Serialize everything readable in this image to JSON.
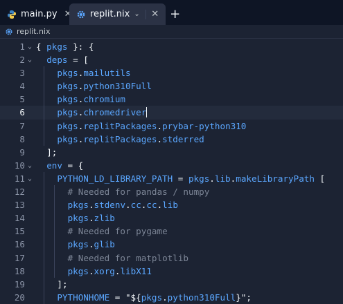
{
  "tabs": [
    {
      "label": "main.py",
      "icon": "python-icon",
      "active": false
    },
    {
      "label": "replit.nix",
      "icon": "nix-gear-icon",
      "active": true
    }
  ],
  "breadcrumb": {
    "label": "replit.nix",
    "icon": "nix-gear-icon"
  },
  "colors": {
    "accent": "#5ba7ff",
    "comment": "#7c8596",
    "background": "#1c2333",
    "tabbar": "#0e1525"
  },
  "editor": {
    "current_line": 6,
    "lines": [
      {
        "n": "1",
        "fold": true,
        "indent": 0,
        "tokens": [
          [
            "punc",
            "{ "
          ],
          [
            "var",
            "pkgs"
          ],
          [
            "punc",
            " }: {"
          ]
        ]
      },
      {
        "n": "2",
        "fold": true,
        "indent": 1,
        "tokens": [
          [
            "var",
            "deps"
          ],
          [
            "punc",
            " = ["
          ]
        ]
      },
      {
        "n": "3",
        "fold": false,
        "indent": 2,
        "tokens": [
          [
            "var",
            "pkgs"
          ],
          [
            "punc",
            "."
          ],
          [
            "attr",
            "mailutils"
          ]
        ]
      },
      {
        "n": "4",
        "fold": false,
        "indent": 2,
        "tokens": [
          [
            "var",
            "pkgs"
          ],
          [
            "punc",
            "."
          ],
          [
            "attr",
            "python310Full"
          ]
        ]
      },
      {
        "n": "5",
        "fold": false,
        "indent": 2,
        "tokens": [
          [
            "var",
            "pkgs"
          ],
          [
            "punc",
            "."
          ],
          [
            "attr",
            "chromium"
          ]
        ]
      },
      {
        "n": "6",
        "fold": false,
        "indent": 2,
        "cursor": true,
        "tokens": [
          [
            "var",
            "pkgs"
          ],
          [
            "punc",
            "."
          ],
          [
            "attr",
            "chromedriver"
          ]
        ]
      },
      {
        "n": "7",
        "fold": false,
        "indent": 2,
        "tokens": [
          [
            "var",
            "pkgs"
          ],
          [
            "punc",
            "."
          ],
          [
            "attr",
            "replitPackages"
          ],
          [
            "punc",
            "."
          ],
          [
            "attr",
            "prybar-python310"
          ]
        ]
      },
      {
        "n": "8",
        "fold": false,
        "indent": 2,
        "tokens": [
          [
            "var",
            "pkgs"
          ],
          [
            "punc",
            "."
          ],
          [
            "attr",
            "replitPackages"
          ],
          [
            "punc",
            "."
          ],
          [
            "attr",
            "stderred"
          ]
        ]
      },
      {
        "n": "9",
        "fold": false,
        "indent": 1,
        "tokens": [
          [
            "punc",
            "];"
          ]
        ]
      },
      {
        "n": "10",
        "fold": true,
        "indent": 1,
        "tokens": [
          [
            "var",
            "env"
          ],
          [
            "punc",
            " = {"
          ]
        ]
      },
      {
        "n": "11",
        "fold": true,
        "indent": 2,
        "tokens": [
          [
            "var",
            "PYTHON_LD_LIBRARY_PATH"
          ],
          [
            "punc",
            " = "
          ],
          [
            "var",
            "pkgs"
          ],
          [
            "punc",
            "."
          ],
          [
            "attr",
            "lib"
          ],
          [
            "punc",
            "."
          ],
          [
            "attr",
            "makeLibraryPath"
          ],
          [
            "punc",
            " ["
          ]
        ]
      },
      {
        "n": "12",
        "fold": false,
        "indent": 3,
        "tokens": [
          [
            "comment",
            "# Needed for pandas / numpy"
          ]
        ]
      },
      {
        "n": "13",
        "fold": false,
        "indent": 3,
        "tokens": [
          [
            "var",
            "pkgs"
          ],
          [
            "punc",
            "."
          ],
          [
            "attr",
            "stdenv"
          ],
          [
            "punc",
            "."
          ],
          [
            "attr",
            "cc"
          ],
          [
            "punc",
            "."
          ],
          [
            "attr",
            "cc"
          ],
          [
            "punc",
            "."
          ],
          [
            "attr",
            "lib"
          ]
        ]
      },
      {
        "n": "14",
        "fold": false,
        "indent": 3,
        "tokens": [
          [
            "var",
            "pkgs"
          ],
          [
            "punc",
            "."
          ],
          [
            "attr",
            "zlib"
          ]
        ]
      },
      {
        "n": "15",
        "fold": false,
        "indent": 3,
        "tokens": [
          [
            "comment",
            "# Needed for pygame"
          ]
        ]
      },
      {
        "n": "16",
        "fold": false,
        "indent": 3,
        "tokens": [
          [
            "var",
            "pkgs"
          ],
          [
            "punc",
            "."
          ],
          [
            "attr",
            "glib"
          ]
        ]
      },
      {
        "n": "17",
        "fold": false,
        "indent": 3,
        "tokens": [
          [
            "comment",
            "# Needed for matplotlib"
          ]
        ]
      },
      {
        "n": "18",
        "fold": false,
        "indent": 3,
        "tokens": [
          [
            "var",
            "pkgs"
          ],
          [
            "punc",
            "."
          ],
          [
            "attr",
            "xorg"
          ],
          [
            "punc",
            "."
          ],
          [
            "attr",
            "libX11"
          ]
        ]
      },
      {
        "n": "19",
        "fold": false,
        "indent": 2,
        "tokens": [
          [
            "punc",
            "];"
          ]
        ]
      },
      {
        "n": "20",
        "fold": false,
        "indent": 2,
        "tokens": [
          [
            "var",
            "PYTHONHOME"
          ],
          [
            "punc",
            " = \"${"
          ],
          [
            "var",
            "pkgs"
          ],
          [
            "punc",
            "."
          ],
          [
            "attr",
            "python310Full"
          ],
          [
            "punc",
            "}\";"
          ]
        ]
      }
    ]
  }
}
